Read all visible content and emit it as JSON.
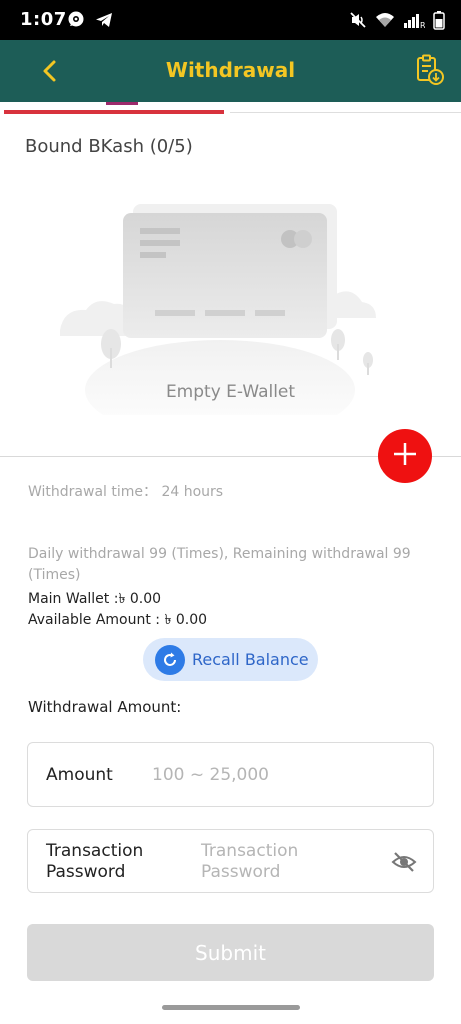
{
  "status_bar": {
    "time": "1:07",
    "signal_label": "R"
  },
  "header": {
    "title": "Withdrawal"
  },
  "wallet_section": {
    "title": "Bound BKash (0/5)",
    "empty_label": "Empty E-Wallet"
  },
  "info": {
    "withdraw_time": "Withdrawal time：  24 hours",
    "daily_limit": "Daily withdrawal 99 (Times), Remaining withdrawal 99 (Times)",
    "main_wallet": "Main Wallet :৳ 0.00",
    "available_amount": "Available Amount : ৳ 0.00"
  },
  "recall_button": {
    "label": "Recall Balance"
  },
  "form": {
    "heading": "Withdrawal Amount:",
    "amount_label": "Amount",
    "amount_placeholder": "100 ~ 25,000",
    "password_label": "Transaction Password",
    "password_placeholder": "Transaction Password",
    "submit_label": "Submit"
  },
  "colors": {
    "header_bg": "#1d5d57",
    "header_title": "#f3c623",
    "active_tab": "#d8323d",
    "add_button": "#ef1111",
    "recall_bg": "#dbe8fb",
    "recall_icon": "#2e7be6",
    "submit_disabled": "#d9d9d9"
  },
  "icons": {
    "back": "chevron-left-icon",
    "record": "clipboard-download-icon",
    "add": "plus-icon",
    "recall": "refresh-icon",
    "password_visibility": "eye-off-icon"
  }
}
